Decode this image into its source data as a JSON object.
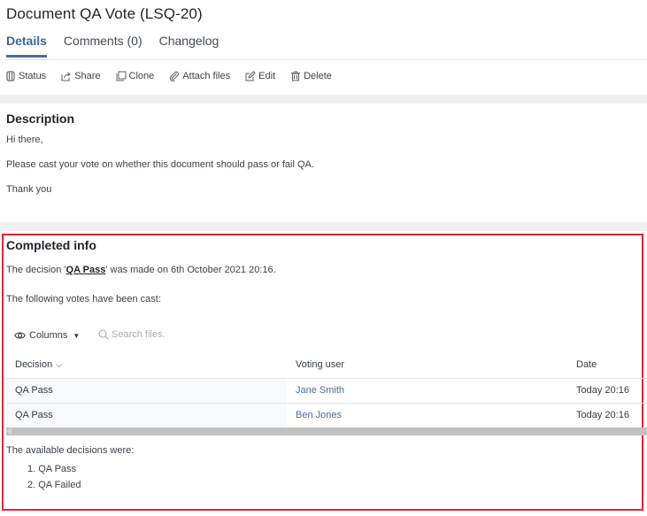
{
  "header": {
    "title": "Document QA Vote (LSQ-20)",
    "tabs": [
      {
        "label": "Details",
        "active": true
      },
      {
        "label": "Comments (0)",
        "active": false
      },
      {
        "label": "Changelog",
        "active": false
      }
    ]
  },
  "toolbar": {
    "items": [
      {
        "label": "Status",
        "icon": "status-icon"
      },
      {
        "label": "Share",
        "icon": "share-icon"
      },
      {
        "label": "Clone",
        "icon": "clone-icon"
      },
      {
        "label": "Attach files",
        "icon": "paperclip-icon"
      },
      {
        "label": "Edit",
        "icon": "edit-icon"
      },
      {
        "label": "Delete",
        "icon": "trash-icon"
      }
    ]
  },
  "description": {
    "title": "Description",
    "lines": [
      "Hi there,",
      "Please cast your vote on whether this document should pass or fail QA.",
      "Thank you"
    ]
  },
  "completed": {
    "title": "Completed info",
    "decision_prefix": "The decision '",
    "decision_value": "QA Pass",
    "decision_suffix": "' was made on 6th October 2021 20:16.",
    "votes_intro": "The following votes have been cast:",
    "columns_button": "Columns",
    "search_placeholder": "Search files.",
    "table": {
      "headers": [
        "Decision",
        "Voting user",
        "Date"
      ],
      "rows": [
        {
          "decision": "QA Pass",
          "user": "Jane Smith",
          "date": "Today 20:16"
        },
        {
          "decision": "QA Pass",
          "user": "Ben Jones",
          "date": "Today 20:16"
        }
      ]
    },
    "available_intro": "The available decisions were:",
    "available_decisions": [
      "1. QA Pass",
      "2. QA Failed"
    ]
  },
  "colors": {
    "accent": "#4a6d9b",
    "highlight_frame": "#e0263a"
  }
}
